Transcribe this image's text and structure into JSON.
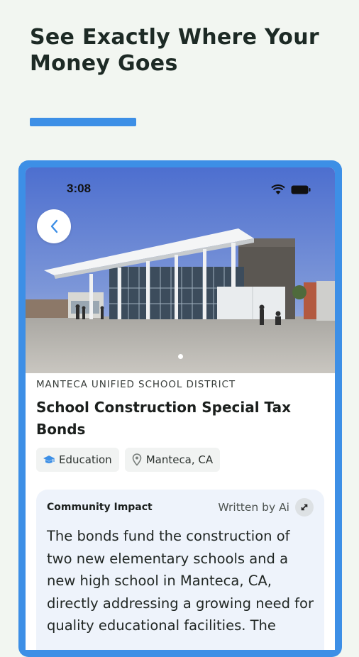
{
  "promo": {
    "headline": "See Exactly Where Your Money Goes",
    "accent_color": "#3d8fe6"
  },
  "status_bar": {
    "time": "3:08",
    "icons": [
      "wifi-icon",
      "battery-icon"
    ]
  },
  "hero": {
    "back_icon": "chevron-left-icon",
    "carousel": {
      "count": 1,
      "active": 0
    }
  },
  "measure": {
    "district": "MANTECA UNIFIED SCHOOL DISTRICT",
    "title": "School Construction Special Tax Bonds",
    "tags": [
      {
        "icon": "graduation-cap-icon",
        "label": "Education"
      },
      {
        "icon": "location-pin-icon",
        "label": "Manteca, CA"
      }
    ]
  },
  "impact": {
    "title": "Community Impact",
    "written_by": "Written by Ai",
    "expand_icon": "expand-arrows-icon",
    "body": "The bonds fund the construction of two new elementary schools and a new high school in Manteca, CA, directly addressing a growing need for quality educational facilities. The"
  }
}
